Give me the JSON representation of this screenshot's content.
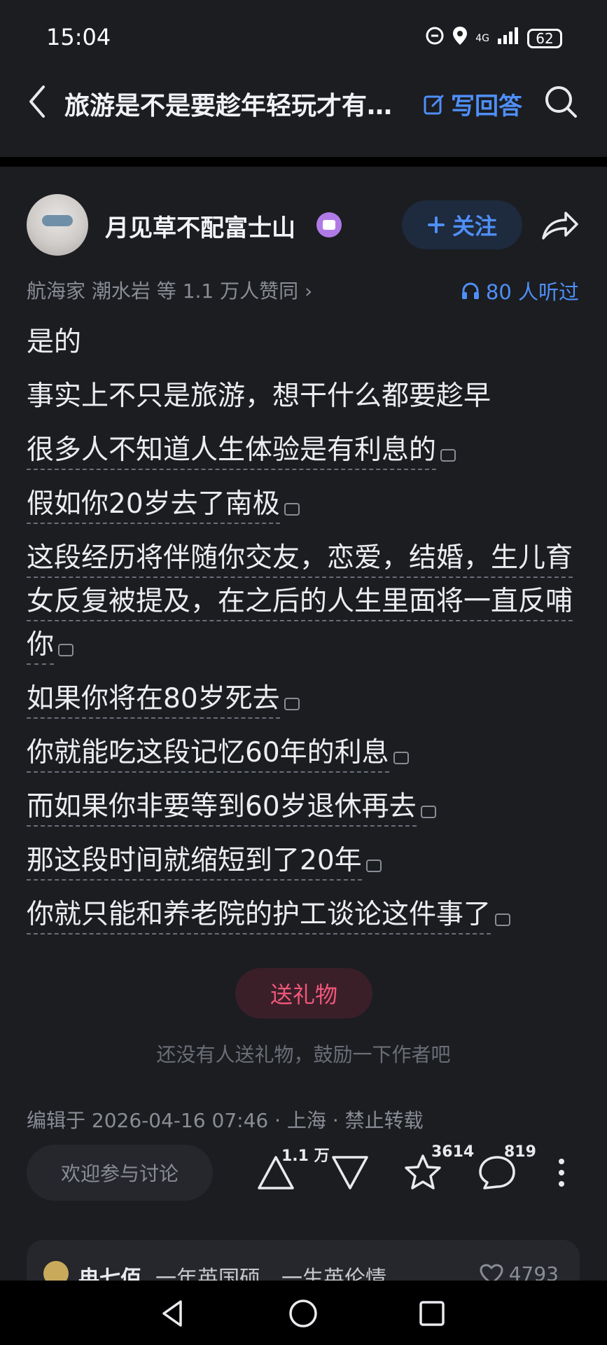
{
  "status": {
    "time": "15:04",
    "network": "4G",
    "battery": "62"
  },
  "nav": {
    "title": "旅游是不是要趁年轻玩才有…",
    "write_answer": "写回答"
  },
  "author": {
    "name": "月见草不配富士山",
    "follow": "关注",
    "likes_line": "航海家 潮水岩 等 1.1 万人赞同 ›",
    "listened": "80 人听过"
  },
  "content": {
    "paragraphs": [
      "是的",
      "事实上不只是旅游，想干什么都要趁早",
      "很多人不知道人生体验是有利息的",
      "假如你20岁去了南极",
      "这段经历将伴随你交友，恋爱，结婚，生儿育女反复被提及，在之后的人生里面将一直反哺你",
      "如果你将在80岁死去",
      "你就能吃这段记忆60年的利息",
      "而如果你非要等到60岁退休再去",
      "那这段时间就缩短到了20年",
      "你就只能和养老院的护工谈论这件事了"
    ]
  },
  "gift": {
    "button": "送礼物",
    "tip": "还没有人送礼物，鼓励一下作者吧"
  },
  "meta": {
    "edit_line": "编辑于 2026-04-16 07:46 · 上海 · 禁止转载"
  },
  "actions": {
    "discuss_placeholder": "欢迎参与讨论",
    "upvotes": "1.1 万",
    "favorites": "3614",
    "comments": "819"
  },
  "comment_preview": {
    "name": "冉七佰",
    "desc": "一年英国硕，一生英伦情",
    "likes": "4793"
  },
  "colors": {
    "accent": "#4f8ff7",
    "gift": "#f0577b",
    "background": "#1b1d21"
  }
}
